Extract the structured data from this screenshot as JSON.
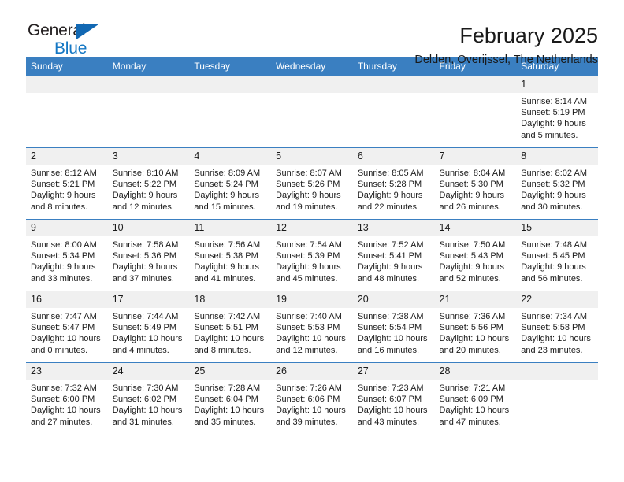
{
  "brand": {
    "line1": "General",
    "line2": "Blue",
    "triangle_color": "#1268b3",
    "text_color": "#231f20",
    "blue_color": "#1477c4"
  },
  "header": {
    "title": "February 2025",
    "subtitle": "Delden, Overijssel, The Netherlands"
  },
  "theme": {
    "header_blue": "#3a7fc1",
    "daynum_bg": "#f0f0f0",
    "cell_bg": "#ffffff",
    "text": "#1a1a1a"
  },
  "weekdays": [
    "Sunday",
    "Monday",
    "Tuesday",
    "Wednesday",
    "Thursday",
    "Friday",
    "Saturday"
  ],
  "weeks": [
    [
      {
        "day": "",
        "info": ""
      },
      {
        "day": "",
        "info": ""
      },
      {
        "day": "",
        "info": ""
      },
      {
        "day": "",
        "info": ""
      },
      {
        "day": "",
        "info": ""
      },
      {
        "day": "",
        "info": ""
      },
      {
        "day": "1",
        "info": "Sunrise: 8:14 AM\nSunset: 5:19 PM\nDaylight: 9 hours\nand 5 minutes."
      }
    ],
    [
      {
        "day": "2",
        "info": "Sunrise: 8:12 AM\nSunset: 5:21 PM\nDaylight: 9 hours\nand 8 minutes."
      },
      {
        "day": "3",
        "info": "Sunrise: 8:10 AM\nSunset: 5:22 PM\nDaylight: 9 hours\nand 12 minutes."
      },
      {
        "day": "4",
        "info": "Sunrise: 8:09 AM\nSunset: 5:24 PM\nDaylight: 9 hours\nand 15 minutes."
      },
      {
        "day": "5",
        "info": "Sunrise: 8:07 AM\nSunset: 5:26 PM\nDaylight: 9 hours\nand 19 minutes."
      },
      {
        "day": "6",
        "info": "Sunrise: 8:05 AM\nSunset: 5:28 PM\nDaylight: 9 hours\nand 22 minutes."
      },
      {
        "day": "7",
        "info": "Sunrise: 8:04 AM\nSunset: 5:30 PM\nDaylight: 9 hours\nand 26 minutes."
      },
      {
        "day": "8",
        "info": "Sunrise: 8:02 AM\nSunset: 5:32 PM\nDaylight: 9 hours\nand 30 minutes."
      }
    ],
    [
      {
        "day": "9",
        "info": "Sunrise: 8:00 AM\nSunset: 5:34 PM\nDaylight: 9 hours\nand 33 minutes."
      },
      {
        "day": "10",
        "info": "Sunrise: 7:58 AM\nSunset: 5:36 PM\nDaylight: 9 hours\nand 37 minutes."
      },
      {
        "day": "11",
        "info": "Sunrise: 7:56 AM\nSunset: 5:38 PM\nDaylight: 9 hours\nand 41 minutes."
      },
      {
        "day": "12",
        "info": "Sunrise: 7:54 AM\nSunset: 5:39 PM\nDaylight: 9 hours\nand 45 minutes."
      },
      {
        "day": "13",
        "info": "Sunrise: 7:52 AM\nSunset: 5:41 PM\nDaylight: 9 hours\nand 48 minutes."
      },
      {
        "day": "14",
        "info": "Sunrise: 7:50 AM\nSunset: 5:43 PM\nDaylight: 9 hours\nand 52 minutes."
      },
      {
        "day": "15",
        "info": "Sunrise: 7:48 AM\nSunset: 5:45 PM\nDaylight: 9 hours\nand 56 minutes."
      }
    ],
    [
      {
        "day": "16",
        "info": "Sunrise: 7:47 AM\nSunset: 5:47 PM\nDaylight: 10 hours\nand 0 minutes."
      },
      {
        "day": "17",
        "info": "Sunrise: 7:44 AM\nSunset: 5:49 PM\nDaylight: 10 hours\nand 4 minutes."
      },
      {
        "day": "18",
        "info": "Sunrise: 7:42 AM\nSunset: 5:51 PM\nDaylight: 10 hours\nand 8 minutes."
      },
      {
        "day": "19",
        "info": "Sunrise: 7:40 AM\nSunset: 5:53 PM\nDaylight: 10 hours\nand 12 minutes."
      },
      {
        "day": "20",
        "info": "Sunrise: 7:38 AM\nSunset: 5:54 PM\nDaylight: 10 hours\nand 16 minutes."
      },
      {
        "day": "21",
        "info": "Sunrise: 7:36 AM\nSunset: 5:56 PM\nDaylight: 10 hours\nand 20 minutes."
      },
      {
        "day": "22",
        "info": "Sunrise: 7:34 AM\nSunset: 5:58 PM\nDaylight: 10 hours\nand 23 minutes."
      }
    ],
    [
      {
        "day": "23",
        "info": "Sunrise: 7:32 AM\nSunset: 6:00 PM\nDaylight: 10 hours\nand 27 minutes."
      },
      {
        "day": "24",
        "info": "Sunrise: 7:30 AM\nSunset: 6:02 PM\nDaylight: 10 hours\nand 31 minutes."
      },
      {
        "day": "25",
        "info": "Sunrise: 7:28 AM\nSunset: 6:04 PM\nDaylight: 10 hours\nand 35 minutes."
      },
      {
        "day": "26",
        "info": "Sunrise: 7:26 AM\nSunset: 6:06 PM\nDaylight: 10 hours\nand 39 minutes."
      },
      {
        "day": "27",
        "info": "Sunrise: 7:23 AM\nSunset: 6:07 PM\nDaylight: 10 hours\nand 43 minutes."
      },
      {
        "day": "28",
        "info": "Sunrise: 7:21 AM\nSunset: 6:09 PM\nDaylight: 10 hours\nand 47 minutes."
      },
      {
        "day": "",
        "info": ""
      }
    ]
  ]
}
